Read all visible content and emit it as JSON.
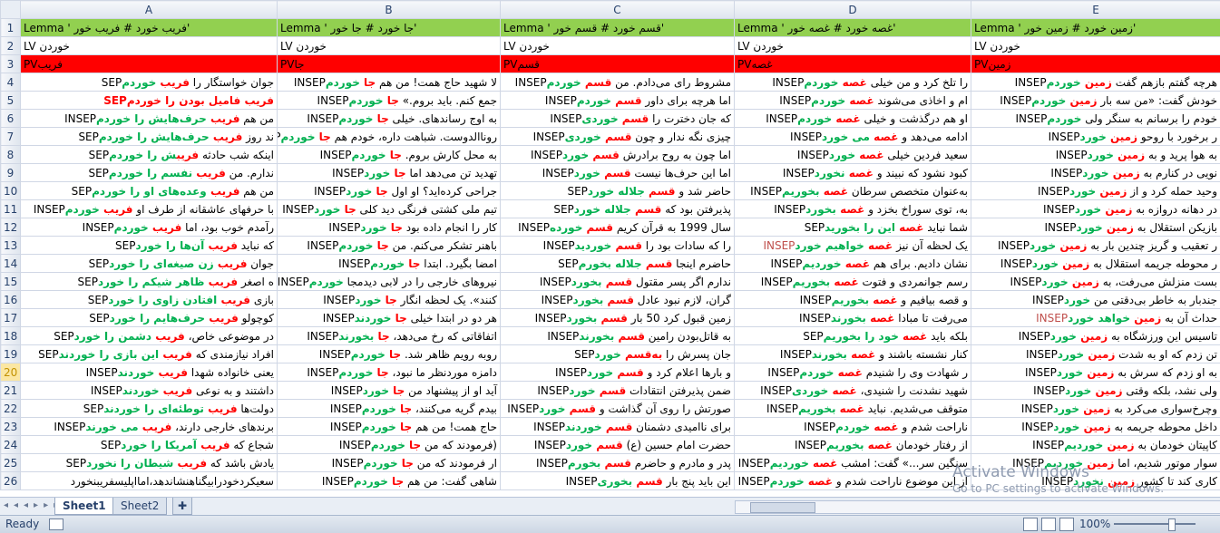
{
  "columns": [
    "A",
    "B",
    "C",
    "D",
    "E"
  ],
  "header_row": [
    "'فریب خورد  #  فریب خور ' Lemma",
    "'جا خورد  #  جا  خور ' Lemma",
    "'قسم خورد  #  قسم خور ' Lemma",
    "'غصه خورد  #  غصه خور ' Lemma",
    "'زمین خورد  #  زمین خور ' Lemma"
  ],
  "row2": [
    "خوردن LV",
    "خوردن LV",
    "خوردن LV",
    "خوردن LV",
    "خوردن LV"
  ],
  "row3": [
    "فریبPV",
    "جاPV",
    "قسمPV",
    "غصهPV",
    "زمینPV"
  ],
  "rows": [
    {
      "n": "4",
      "cells": [
        {
          "ctx": "جوان خواستگار را ",
          "kw": "فریب",
          "tail": " خوردم",
          "tag": "SEP"
        },
        {
          "ctx": "لا شهید حاج همت! من هم ",
          "kw": "جا",
          "tail": " خوردم",
          "tag": "INSEP"
        },
        {
          "ctx": "مشروط رای می‌دادم. من ",
          "kw": "قسم",
          "tail": " خوردم",
          "tag": "INSEP"
        },
        {
          "ctx": "را تلخ کرد و من خیلی ",
          "kw": "غصه",
          "tail": " خوردم",
          "tag": "INSEP"
        },
        {
          "ctx": "هرچه گفتم بازهم گفت ",
          "kw": "زمین",
          "tail": " خوردم",
          "tag": "INSEP"
        }
      ]
    },
    {
      "n": "5",
      "cells": [
        {
          "ctx": "",
          "kw": "فریب فامیل بودن را خوردم",
          "tail": "",
          "tag": "SEP",
          "red": true
        },
        {
          "ctx": "جمع کنم. باید بروم.» ",
          "kw": "جا",
          "tail": " خوردم",
          "tag": "INSEP"
        },
        {
          "ctx": "اما هرچه برای داور ",
          "kw": "قسم",
          "tail": " خوردم",
          "tag": "INSEP"
        },
        {
          "ctx": "ام و اخاذی می‌شوند ",
          "kw": "غصه",
          "tail": " خوردم",
          "tag": "INSEP"
        },
        {
          "ctx": "خودش گفت: «من سه بار ",
          "kw": "زمین",
          "tail": " خوردم",
          "tag": "INSEP"
        }
      ]
    },
    {
      "n": "6",
      "cells": [
        {
          "ctx": "من هم ",
          "kw": "فریب",
          "tail": " حرف‌هایش را خوردم",
          "tag": "INSEP"
        },
        {
          "ctx": "به اوج رساندهای. خیلی ",
          "kw": "جا",
          "tail": " خوردم",
          "tag": "INSEP"
        },
        {
          "ctx": "که جان دخترت را ",
          "kw": "قسم",
          "tail": " خوردی",
          "tag": "INSEP"
        },
        {
          "ctx": "او هم درگذشت و خیلی ",
          "kw": "غصه",
          "tail": " خوردم",
          "tag": "INSEP"
        },
        {
          "ctx": "خودم را برسانم به سنگر ولی ",
          "kw": "",
          "tail": "خوردم",
          "tag": "INSEP"
        }
      ]
    },
    {
      "n": "7",
      "cells": [
        {
          "ctx": "ند روز ",
          "kw": "فریب",
          "tail": " حرف‌هایش را خوردم",
          "tag": "SEP"
        },
        {
          "ctx": "روناالدوست. شباهت داره، خودم هم ",
          "kw": "جا",
          "tail": " خوردم",
          "tag": "SEP"
        },
        {
          "ctx": "چیزی نگه ندار و چون ",
          "kw": "قسم",
          "tail": " خوردی",
          "tag": "INSEP"
        },
        {
          "ctx": "ادامه می‌دهد و ",
          "kw": "غصه",
          "tail": " می خورد",
          "tag": "INSEP"
        },
        {
          "ctx": "ر برخورد با روحو ",
          "kw": "زمین",
          "tail": " خورد",
          "tag": "INSEP"
        }
      ]
    },
    {
      "n": "8",
      "cells": [
        {
          "ctx": "اینکه شب حادثه ",
          "kw": "فریب",
          "tail": "ش را خوردم",
          "tag": "SEP"
        },
        {
          "ctx": "به محل کارش بروم. ",
          "kw": "جا",
          "tail": " خوردم",
          "tag": "INSEP"
        },
        {
          "ctx": "اما چون به روح برادرش ",
          "kw": "قسم",
          "tail": " خورد",
          "tag": "INSEP"
        },
        {
          "ctx": "سعید فردین خیلی ",
          "kw": "غصه",
          "tail": " خورد",
          "tag": "INSEP"
        },
        {
          "ctx": "به هوا پرید و به ",
          "kw": "زمین",
          "tail": " خورد",
          "tag": "INSEP"
        }
      ]
    },
    {
      "n": "9",
      "cells": [
        {
          "ctx": "ندارم. من ",
          "kw": "فریب",
          "tail": " نفسم را خوردم",
          "tag": "SEP"
        },
        {
          "ctx": "تهدید تن می‌دهد اما ",
          "kw": "جا",
          "tail": " خورد",
          "tag": "INSEP"
        },
        {
          "ctx": "اما این حرف‌ها نیست ",
          "kw": "قسم",
          "tail": " خورد",
          "tag": "INSEP"
        },
        {
          "ctx": "کبود نشود که نبیند و ",
          "kw": "غصه",
          "tail": " نخورد",
          "tag": "INSEP"
        },
        {
          "ctx": "نویی در کنارم به ",
          "kw": "زمین",
          "tail": " خورد",
          "tag": "INSEP"
        }
      ]
    },
    {
      "n": "10",
      "cells": [
        {
          "ctx": "من هم ",
          "kw": "فریب",
          "tail": " وعده‌های او را خوردم",
          "tag": "SEP"
        },
        {
          "ctx": "جراحی کرده‌اید؟ او اول ",
          "kw": "جا",
          "tail": " خورد",
          "tag": "INSEP"
        },
        {
          "ctx": "حاضر شد و ",
          "kw": "قسم",
          "tail": " جلاله خورد",
          "tag": "SEP"
        },
        {
          "ctx": "به‌عنوان متخصص سرطان ",
          "kw": "غصه",
          "tail": " بخوریم",
          "tag": "INSEP"
        },
        {
          "ctx": "وحید حمله کرد و از ",
          "kw": "زمین",
          "tail": " خورد",
          "tag": "INSEP"
        }
      ]
    },
    {
      "n": "11",
      "cells": [
        {
          "ctx": "با حرفهای عاشقانه از طرف او ",
          "kw": "فریب",
          "tail": " خوردم",
          "tag": "INSEP"
        },
        {
          "ctx": "تیم ملی کشتی فرنگی دید کلی ",
          "kw": "جا",
          "tail": " خورد",
          "tag": "INSEP"
        },
        {
          "ctx": "پذیرفتن بود که ",
          "kw": "قسم",
          "tail": " جلاله خورد",
          "tag": "SEP"
        },
        {
          "ctx": "به، توی سوراخ بخزد و ",
          "kw": "غصه",
          "tail": " بخورد",
          "tag": "INSEP"
        },
        {
          "ctx": "در دهانه دروازه به ",
          "kw": "زمین",
          "tail": " خورد",
          "tag": "INSEP"
        }
      ]
    },
    {
      "n": "12",
      "cells": [
        {
          "ctx": "رآمدم خوب بود، اما ",
          "kw": "فریب",
          "tail": " خوردم",
          "tag": "INSEP"
        },
        {
          "ctx": "کار را انجام داده بود ",
          "kw": "جا",
          "tail": " خورد",
          "tag": "INSEP"
        },
        {
          "ctx": "سال 1999 به قرآن کریم ",
          "kw": "قسم",
          "tail": " خورده",
          "tag": "INSEP"
        },
        {
          "ctx": "شما نباید ",
          "kw": "غصه",
          "tail": " این را بخورید",
          "tag": "SEP"
        },
        {
          "ctx": "بازیکن استقلال به ",
          "kw": "زمین",
          "tail": " خورد",
          "tag": "INSEP"
        }
      ]
    },
    {
      "n": "13",
      "cells": [
        {
          "ctx": "که نباید ",
          "kw": "فریب",
          "tail": " آن‌ها را خورد",
          "tag": "SEP"
        },
        {
          "ctx": "باهنر تشکر می‌کنم. من ",
          "kw": "جا",
          "tail": " خوردم",
          "tag": "INSEP"
        },
        {
          "ctx": "را که سادات بود را ",
          "kw": "قسم",
          "tail": " خوردید",
          "tag": "INSEP"
        },
        {
          "ctx": "یک لحظه آن نیز ",
          "kw": "غصه",
          "tail": " خواهیم خورد",
          "tag": "INSEP",
          "orange": true
        },
        {
          "ctx": "ر تعقیب و گریز چندین بار به ",
          "kw": "زمین",
          "tail": " خورد",
          "tag": "INSEP"
        }
      ]
    },
    {
      "n": "14",
      "cells": [
        {
          "ctx": "جوان ",
          "kw": "فریب",
          "tail": " زن صیغه‌ای را خورد",
          "tag": "SEP"
        },
        {
          "ctx": "امضا بگیرد. ابتدا ",
          "kw": "جا",
          "tail": " خوردم",
          "tag": "INSEP"
        },
        {
          "ctx": "حاضرم اینجا ",
          "kw": "قسم",
          "tail": " جلاله بخورم",
          "tag": "SEP"
        },
        {
          "ctx": "نشان دادیم. برای هم ",
          "kw": "غصه",
          "tail": " خوردیم",
          "tag": "INSEP"
        },
        {
          "ctx": "ر محوطه جریمه استقلال به ",
          "kw": "زمین",
          "tail": " خورد",
          "tag": "INSEP"
        }
      ]
    },
    {
      "n": "15",
      "cells": [
        {
          "ctx": "ه اصغر ",
          "kw": "فریب",
          "tail": " ظاهر شیکم را خورد",
          "tag": "SEP"
        },
        {
          "ctx": "نیروهای خارجی را در لابی دیدمجا ",
          "kw": "",
          "tail": "خوردم",
          "tag": "INSEP"
        },
        {
          "ctx": "ندارم اگر پسر مقتول ",
          "kw": "قسم",
          "tail": " بخورد",
          "tag": "INSEP"
        },
        {
          "ctx": "رسم جوانمردی و فتوت ",
          "kw": "غصه",
          "tail": " بخوریم",
          "tag": "INSEP"
        },
        {
          "ctx": "بست منزلش می‌رفت، به ",
          "kw": "زمین",
          "tail": " خورد",
          "tag": "INSEP"
        }
      ]
    },
    {
      "n": "16",
      "cells": [
        {
          "ctx": "بازی ",
          "kw": "فریب",
          "tail": " افتادن زاوی را خورد",
          "tag": "SEP"
        },
        {
          "ctx": "کنند». یک لحظه انگار ",
          "kw": "جا",
          "tail": " خورد",
          "tag": "INSEP"
        },
        {
          "ctx": "گران، لازم نبود عادل ",
          "kw": "قسم",
          "tail": " بخورد",
          "tag": "INSEP"
        },
        {
          "ctx": "و قصه بیافیم و ",
          "kw": "غصه",
          "tail": " بخوریم",
          "tag": "INSEP"
        },
        {
          "ctx": "جندبار به خاطر بی‌دقتی من ",
          "kw": "",
          "tail": "خورد",
          "tag": "INSEP"
        }
      ]
    },
    {
      "n": "17",
      "cells": [
        {
          "ctx": "کوچولو ",
          "kw": "فریب",
          "tail": " حرف‌هایم را خورد",
          "tag": "SEP"
        },
        {
          "ctx": "هر دو در ابتدا خیلی ",
          "kw": "جا",
          "tail": " خوردند",
          "tag": "INSEP"
        },
        {
          "ctx": "زمین قبول کرد 50 بار ",
          "kw": "قسم",
          "tail": " بخورد",
          "tag": "INSEP"
        },
        {
          "ctx": "می‌رفت تا مبادا ",
          "kw": "غصه",
          "tail": " بخورند",
          "tag": "INSEP"
        },
        {
          "ctx": "حداث آن به ",
          "kw": "زمین",
          "tail": " خواهد خورد",
          "tag": "INSEP",
          "orange": true
        }
      ]
    },
    {
      "n": "18",
      "cells": [
        {
          "ctx": "در موضوعی خاص، ",
          "kw": "فریب",
          "tail": " دشمن را خورد",
          "tag": "SEP"
        },
        {
          "ctx": "اتفاقاتی که رخ می‌دهد، ",
          "kw": "جا",
          "tail": " بخورند",
          "tag": "INSEP"
        },
        {
          "ctx": "به قاتل‌بودن رامین ",
          "kw": "قسم",
          "tail": " بخورند",
          "tag": "INSEP"
        },
        {
          "ctx": "بلکه باید ",
          "kw": "غصه",
          "tail": " خود را بخوریم",
          "tag": "SEP"
        },
        {
          "ctx": "تاسیس این ورزشگاه به ",
          "kw": "زمین",
          "tail": " خورد",
          "tag": "INSEP"
        }
      ]
    },
    {
      "n": "19",
      "cells": [
        {
          "ctx": "افراد نیازمندی که ",
          "kw": "فریب",
          "tail": " این بازی را خوردند",
          "tag": "SEP"
        },
        {
          "ctx": "روبه رویم ظاهر شد. ",
          "kw": "جا",
          "tail": " خوردم",
          "tag": "INSEP"
        },
        {
          "ctx": "جان پسرش را ",
          "kw": "به‌قسم",
          "tail": " خورد",
          "tag": "SEP"
        },
        {
          "ctx": "کنار نشسته باشند و ",
          "kw": "غصه",
          "tail": " بخورند",
          "tag": "INSEP"
        },
        {
          "ctx": "تن زدم که او به شدت ",
          "kw": "زمین",
          "tail": " خورد",
          "tag": "INSEP"
        }
      ]
    },
    {
      "n": "20",
      "cells": [
        {
          "ctx": "یعنی خانواده شهدا ",
          "kw": "فریب",
          "tail": " خوردند",
          "tag": "INSEP"
        },
        {
          "ctx": "دامزه موردنظر ما نبود، ",
          "kw": "جا",
          "tail": " خوردم",
          "tag": "INSEP"
        },
        {
          "ctx": "و بارها اعلام کرد و ",
          "kw": "قسم",
          "tail": " خورد",
          "tag": "INSEP"
        },
        {
          "ctx": "ر شهادت وی را شنیدم ",
          "kw": "غصه",
          "tail": " خوردم",
          "tag": "INSEP"
        },
        {
          "ctx": "به او زدم که سرش به ",
          "kw": "زمین",
          "tail": " خورد",
          "tag": "INSEP"
        }
      ]
    },
    {
      "n": "21",
      "cells": [
        {
          "ctx": "داشتند و به نوعی ",
          "kw": "فریب",
          "tail": " خوردند",
          "tag": "INSEP"
        },
        {
          "ctx": "آید او از پیشنهاد من ",
          "kw": "جا",
          "tail": " خورد",
          "tag": "INSEP"
        },
        {
          "ctx": "ضمن پذیرفتن انتقادات ",
          "kw": "قسم",
          "tail": " خورد",
          "tag": "INSEP"
        },
        {
          "ctx": "شهید نشدنت را شنیدی، ",
          "kw": "غصه",
          "tail": " خوردی",
          "tag": "INSEP"
        },
        {
          "ctx": "ولی نشد، بلکه وقتی ",
          "kw": "زمین",
          "tail": " خورد",
          "tag": "INSEP"
        }
      ]
    },
    {
      "n": "22",
      "cells": [
        {
          "ctx": "دولت‌ها ",
          "kw": "فریب",
          "tail": " توطئه‌ای را خوردند",
          "tag": "SEP"
        },
        {
          "ctx": "بیدم گریه می‌کنند، ",
          "kw": "جا",
          "tail": " خوردم",
          "tag": "INSEP"
        },
        {
          "ctx": "صورتش را روی آن گذاشت و ",
          "kw": "قسم",
          "tail": " خورد",
          "tag": "INSEP"
        },
        {
          "ctx": "متوقف می‌شدیم. نباید ",
          "kw": "غصه",
          "tail": " بخوریم",
          "tag": "INSEP"
        },
        {
          "ctx": "وچرخ‌سواری می‌کرد به ",
          "kw": "زمین",
          "tail": " خورد",
          "tag": "INSEP"
        }
      ]
    },
    {
      "n": "23",
      "cells": [
        {
          "ctx": "برندهای خارجی دارند، ",
          "kw": "فریب",
          "tail": " می خورند",
          "tag": "INSEP"
        },
        {
          "ctx": "حاج همت! من هم ",
          "kw": "جا",
          "tail": " خوردم",
          "tag": "INSEP"
        },
        {
          "ctx": "برای ناامیدی دشمنان ",
          "kw": "قسم",
          "tail": " خوردند",
          "tag": "INSEP"
        },
        {
          "ctx": "ناراحت شدم و ",
          "kw": "غصه",
          "tail": " خوردم",
          "tag": "INSEP"
        },
        {
          "ctx": "داخل محوطه جریمه به ",
          "kw": "زمین",
          "tail": " خورد",
          "tag": "INSEP"
        }
      ]
    },
    {
      "n": "24",
      "cells": [
        {
          "ctx": "شجاع که ",
          "kw": "فریب",
          "tail": " آمریکا را خورد",
          "tag": "SEP"
        },
        {
          "ctx": "(فرمودند که من ",
          "kw": "جا",
          "tail": " خوردم",
          "tag": "INSEP"
        },
        {
          "ctx": "حضرت امام حسین (ع) ",
          "kw": "قسم",
          "tail": " خورد",
          "tag": "INSEP"
        },
        {
          "ctx": "از رفتار خودمان ",
          "kw": "غصه",
          "tail": " بخوریم",
          "tag": "INSEP"
        },
        {
          "ctx": "کاپیتان خودمان به ",
          "kw": "زمین",
          "tail": " خوردیم",
          "tag": "INSEP"
        }
      ]
    },
    {
      "n": "25",
      "cells": [
        {
          "ctx": "یادش باشد که ",
          "kw": "فریب",
          "tail": " شیطان را نخورد",
          "tag": "SEP"
        },
        {
          "ctx": "ار فرمودند که من ",
          "kw": "جا",
          "tail": " خوردم",
          "tag": "INSEP"
        },
        {
          "ctx": "پدر و مادرم و حاضرم ",
          "kw": "قسم",
          "tail": " بخورم",
          "tag": "INSEP"
        },
        {
          "ctx": "سنگین سر...» گفت: امشب ",
          "kw": "غصه",
          "tail": " خوردیم",
          "tag": "INSEP"
        },
        {
          "ctx": "سوار موتور شدیم، اما ",
          "kw": "زمین",
          "tail": " خوردیم",
          "tag": "INSEP"
        }
      ]
    },
    {
      "n": "26",
      "cells": [
        {
          "ctx": "سعیکردخودرابیگناهنشاندهد،امااپلیسفریبنخورد",
          "kw": "",
          "tail": "",
          "tag": ""
        },
        {
          "ctx": "شاهی گفت: من هم ",
          "kw": "جا",
          "tail": " خوردم",
          "tag": "INSEP"
        },
        {
          "ctx": "این باید پنج بار ",
          "kw": "قسم",
          "tail": " بخوری",
          "tag": "INSEP"
        },
        {
          "ctx": "از این موضوع ناراحت شدم و ",
          "kw": "غصه",
          "tail": " خوردم",
          "tag": "INSEP"
        },
        {
          "ctx": "کاری کند تا کشور ",
          "kw": "زمین",
          "tail": " نخورد",
          "tag": "INSEP"
        }
      ]
    }
  ],
  "tabs": [
    "Sheet1",
    "Sheet2"
  ],
  "status": {
    "ready": "Ready",
    "zoom": "100%"
  },
  "watermark": {
    "line1": "Activate Windows",
    "line2": "Go to PC settings to activate Windows."
  }
}
